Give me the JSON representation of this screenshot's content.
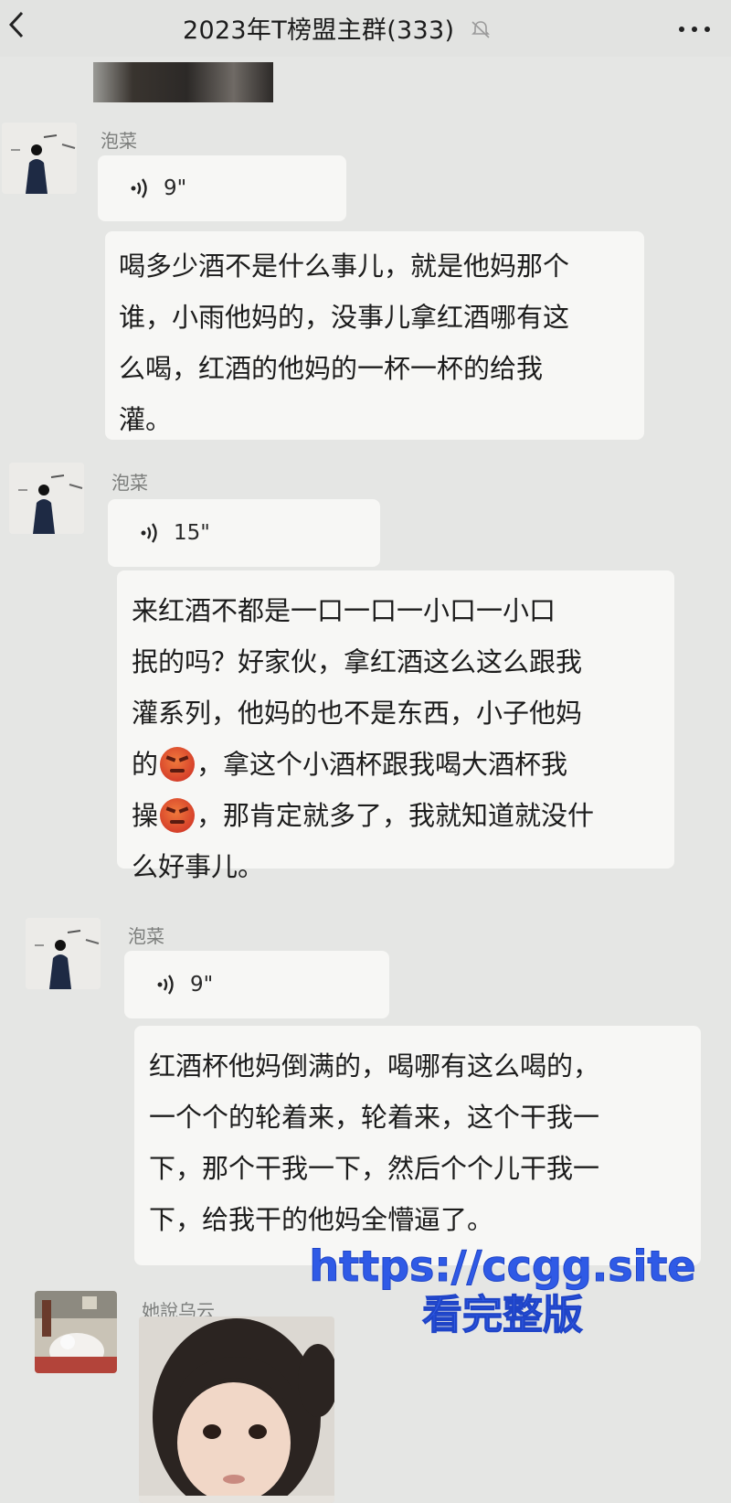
{
  "header": {
    "title": "2023年T榜盟主群(333)",
    "back_icon": "chevron-left-icon",
    "mute_icon": "bell-muted-icon",
    "more_icon": "ellipsis-icon"
  },
  "messages": [
    {
      "sender": "泡菜",
      "voice_duration": "9\"",
      "lines": [
        "喝多少酒不是什么事儿，就是他妈那个",
        "谁，小雨他妈的，没事儿拿红酒哪有这",
        "么喝，红酒的他妈的一杯一杯的给我",
        "灌。"
      ]
    },
    {
      "sender": "泡菜",
      "voice_duration": "15\"",
      "lines": [
        "来红酒不都是一口一口一小口一小口",
        "抿的吗？好家伙，拿红酒这么这么跟我",
        "灌系列，他妈的也不是东西，小子他妈",
        [
          "的",
          "，拿这个小酒杯跟我喝大酒杯我"
        ],
        [
          "操",
          "，那肯定就多了，我就知道就没什"
        ],
        "么好事儿。"
      ],
      "emoji": "angry-face-emoji"
    },
    {
      "sender": "泡菜",
      "voice_duration": "9\"",
      "lines": [
        "红酒杯他妈倒满的，喝哪有这么喝的，",
        "一个个的轮着来，轮着来，这个干我一",
        "下，那个干我一下，然后个个儿干我一",
        "下，给我干的他妈全懵逼了。"
      ]
    },
    {
      "sender": "她說乌云",
      "type": "sticker"
    }
  ],
  "watermark": {
    "url": "https://ccgg.site",
    "text": "看完整版",
    "color": "#2f5ae6"
  },
  "colors": {
    "background": "#e5e6e4",
    "bubble": "#f7f7f5",
    "sender_name": "#7c7e7c",
    "emoji": "#d6402a"
  }
}
